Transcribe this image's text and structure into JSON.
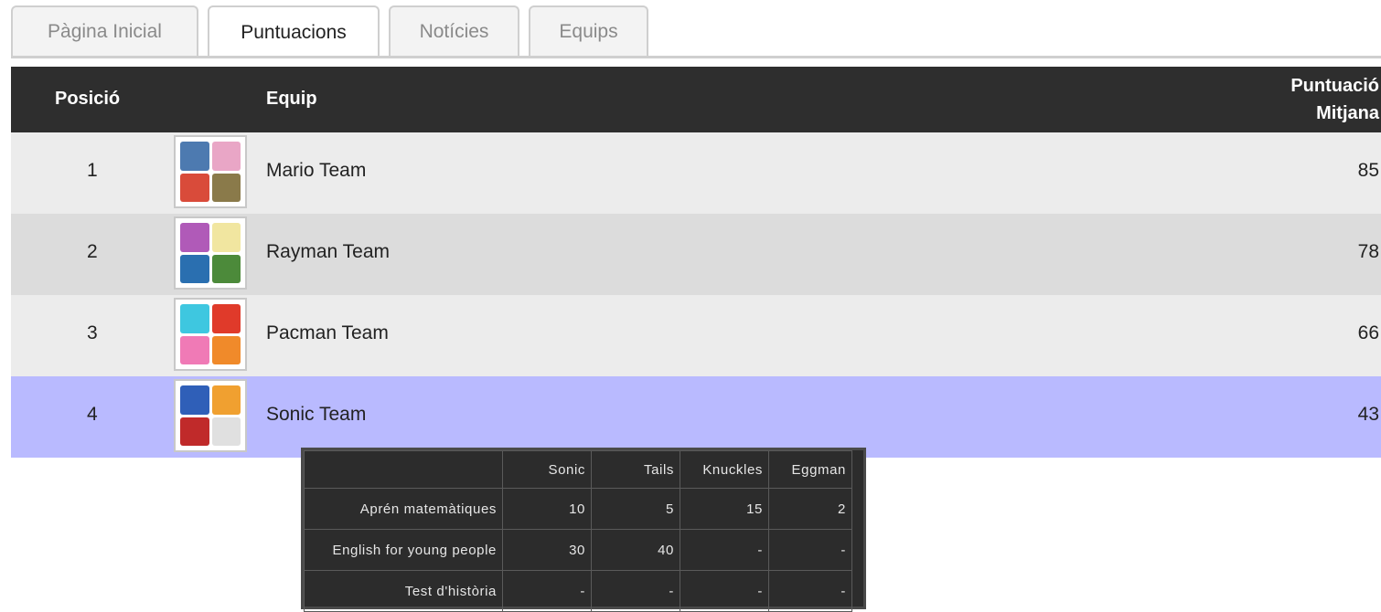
{
  "tabs": [
    {
      "label": "Pàgina Inicial",
      "active": false
    },
    {
      "label": "Puntuacions",
      "active": true
    },
    {
      "label": "Notícies",
      "active": false
    },
    {
      "label": "Equips",
      "active": false
    }
  ],
  "table": {
    "headers": {
      "position": "Posició",
      "team": "Equip",
      "score_line1": "Puntuació",
      "score_line2": "Mitjana"
    },
    "rows": [
      {
        "position": "1",
        "team": "Mario Team",
        "score": "85",
        "avatar_colors": [
          "#4d7ab0",
          "#e9a6c6",
          "#d94b3a",
          "#8a7a4a"
        ]
      },
      {
        "position": "2",
        "team": "Rayman Team",
        "score": "78",
        "avatar_colors": [
          "#b05ab8",
          "#f1e6a0",
          "#2a6fb0",
          "#4c8a3a"
        ]
      },
      {
        "position": "3",
        "team": "Pacman Team",
        "score": "66",
        "avatar_colors": [
          "#3ec7e0",
          "#e03a2a",
          "#f07ab6",
          "#f08a2a"
        ]
      },
      {
        "position": "4",
        "team": "Sonic Team",
        "score": "43",
        "avatar_colors": [
          "#2f5fb8",
          "#f0a030",
          "#c02a2a",
          "#e0e0e0"
        ]
      }
    ]
  },
  "detail": {
    "columns": [
      "",
      "Sonic",
      "Tails",
      "Knuckles",
      "Eggman"
    ],
    "rows": [
      {
        "label": "Aprén matemàtiques",
        "values": [
          "10",
          "5",
          "15",
          "2"
        ]
      },
      {
        "label": "English for young people",
        "values": [
          "30",
          "40",
          "-",
          "-"
        ]
      },
      {
        "label": "Test d'història",
        "values": [
          "-",
          "-",
          "-",
          "-"
        ]
      }
    ]
  },
  "colors": {
    "header_bg": "#2e2e2e",
    "row_light": "#ececec",
    "row_dark": "#dcdcdc",
    "row_highlight": "#b9baff"
  }
}
